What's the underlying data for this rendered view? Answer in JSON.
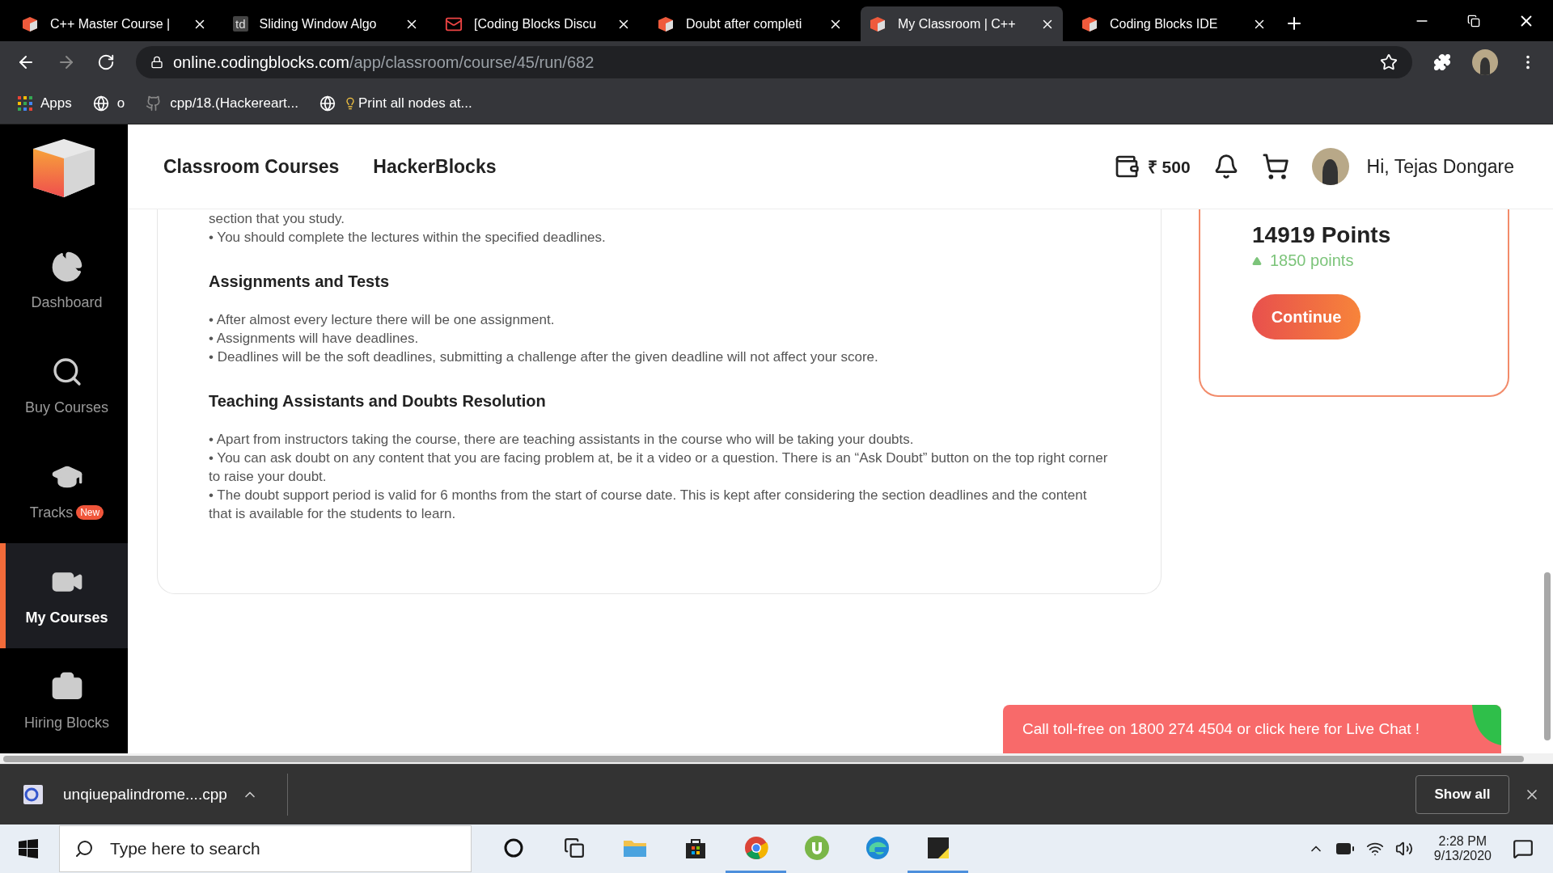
{
  "browser": {
    "tabs": [
      {
        "kind": "cube",
        "title": "C++ Master Course |",
        "selected": false
      },
      {
        "kind": "letters",
        "icon_text": "td",
        "title": "Sliding Window Algo",
        "selected": false
      },
      {
        "kind": "mail",
        "title": "[Coding Blocks Discu",
        "selected": false
      },
      {
        "kind": "cube",
        "title": "Doubt after completi",
        "selected": false
      },
      {
        "kind": "cube",
        "title": "My Classroom | C++",
        "selected": true
      },
      {
        "kind": "cube",
        "title": "Coding Blocks IDE",
        "selected": false
      }
    ],
    "url_host": "online.codingblocks.com",
    "url_path": "/app/classroom/course/45/run/682",
    "bookmarks": [
      {
        "kind": "apps",
        "label": "Apps"
      },
      {
        "kind": "globe",
        "label": "o"
      },
      {
        "kind": "github",
        "label": "cpp/18.(Hackereart..."
      },
      {
        "kind": "globe-bulb",
        "label": "Print all nodes at..."
      }
    ]
  },
  "sidebar": {
    "items": [
      {
        "kind": "dashboard",
        "label": "Dashboard",
        "selected": false
      },
      {
        "kind": "search",
        "label": "Buy Courses",
        "selected": false
      },
      {
        "kind": "tracks",
        "label": "Tracks",
        "badge": "New",
        "selected": false
      },
      {
        "kind": "video",
        "label": "My Courses",
        "selected": true
      },
      {
        "kind": "briefcase",
        "label": "Hiring Blocks",
        "selected": false
      }
    ]
  },
  "header": {
    "nav": [
      "Classroom Courses",
      "HackerBlocks"
    ],
    "wallet": "₹ 500",
    "greeting": "Hi, Tejas Dongare"
  },
  "content": [
    {
      "kind": "text",
      "text": "section that you study."
    },
    {
      "kind": "text",
      "text": "• You should complete the lectures within the specified deadlines."
    },
    {
      "kind": "heading",
      "text": "Assignments and Tests"
    },
    {
      "kind": "text",
      "text": "• After almost every lecture there will be one assignment."
    },
    {
      "kind": "text",
      "text": "• Assignments will have deadlines."
    },
    {
      "kind": "text",
      "text": "• Deadlines will be the soft deadlines, submitting a challenge after the given deadline will not affect your score."
    },
    {
      "kind": "heading",
      "text": "Teaching Assistants and Doubts Resolution"
    },
    {
      "kind": "text",
      "text": "• Apart from instructors taking the course, there are teaching assistants in the course who will be taking your doubts."
    },
    {
      "kind": "text",
      "text": "• You can ask doubt on any content that you are facing problem at, be it a video or a question. There is an “Ask Doubt” button on the top right corner to raise your doubt."
    },
    {
      "kind": "text",
      "text": "• The doubt support period is valid for 6 months from the start of course date. This is kept after considering the section deadlines and the content that is available for the students to learn."
    }
  ],
  "points": {
    "total": "14919 Points",
    "gain": "1850 points",
    "button": "Continue"
  },
  "chat_banner": "Call toll-free on 1800 274 4504 or click here for Live Chat !",
  "downloads": {
    "file": "unqiuepalindrome....cpp",
    "show_all": "Show all"
  },
  "taskbar": {
    "search_placeholder": "Type here to search",
    "apps": [
      {
        "kind": "cortana",
        "active": false
      },
      {
        "kind": "taskview",
        "active": false
      },
      {
        "kind": "explorer",
        "active": false
      },
      {
        "kind": "store",
        "active": false
      },
      {
        "kind": "chrome",
        "active": true
      },
      {
        "kind": "torrent",
        "active": false
      },
      {
        "kind": "edge",
        "active": false
      },
      {
        "kind": "notes",
        "active": true
      }
    ],
    "time": "2:28 PM",
    "date": "9/13/2020"
  }
}
